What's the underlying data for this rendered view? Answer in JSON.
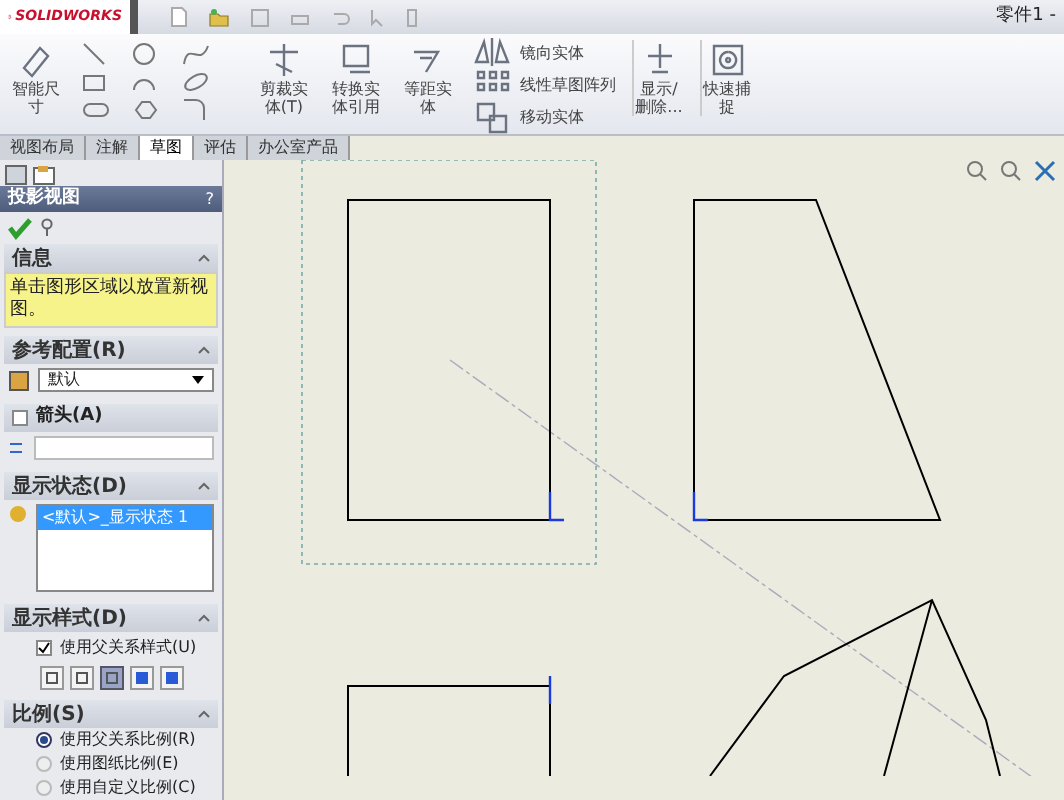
{
  "title_bar": {
    "app_name": "SOLIDWORKS",
    "document_title": "零件1 -"
  },
  "ribbon": {
    "large_tools": [
      {
        "label": "智能尺寸",
        "kind": "dimension"
      },
      {
        "label": "剪裁实体(T)",
        "kind": "trim"
      },
      {
        "label": "转换实体引用",
        "kind": "convert"
      },
      {
        "label": "等距实体",
        "kind": "offset"
      }
    ],
    "small_tools": [
      {
        "label": "镜向实体",
        "kind": "mirror"
      },
      {
        "label": "线性草图阵列",
        "kind": "pattern"
      },
      {
        "label": "移动实体",
        "kind": "move"
      }
    ],
    "end_tools": [
      {
        "label": "显示/删除...",
        "kind": "relations"
      },
      {
        "label": "快速捕捉",
        "kind": "snap"
      }
    ]
  },
  "tabs": [
    {
      "label": "视图布局",
      "selected": false
    },
    {
      "label": "注解",
      "selected": false
    },
    {
      "label": "草图",
      "selected": true
    },
    {
      "label": "评估",
      "selected": false
    },
    {
      "label": "办公室产品",
      "selected": false
    }
  ],
  "panel": {
    "title": "投影视图",
    "help": "?",
    "info": {
      "title": "信息",
      "message": "单击图形区域以放置新视图。"
    },
    "reference": {
      "title": "参考配置(R)",
      "value": "默认"
    },
    "arrow": {
      "title": "箭头(A)",
      "checked": false
    },
    "display_state": {
      "title": "显示状态(D)",
      "items": [
        {
          "label": "<默认>_显示状态 1",
          "selected": true
        }
      ]
    },
    "display_style": {
      "title": "显示样式(D)",
      "use_parent": {
        "label": "使用父关系样式(U)",
        "checked": true
      },
      "styles": [
        {
          "selected": false
        },
        {
          "selected": false
        },
        {
          "selected": true
        },
        {
          "selected": false
        },
        {
          "selected": false
        }
      ]
    },
    "scale": {
      "title": "比例(S)",
      "options": [
        {
          "label": "使用父关系比例(R)",
          "selected": true
        },
        {
          "label": "使用图纸比例(E)",
          "selected": false
        },
        {
          "label": "使用自定义比例(C)",
          "selected": false
        }
      ]
    }
  }
}
